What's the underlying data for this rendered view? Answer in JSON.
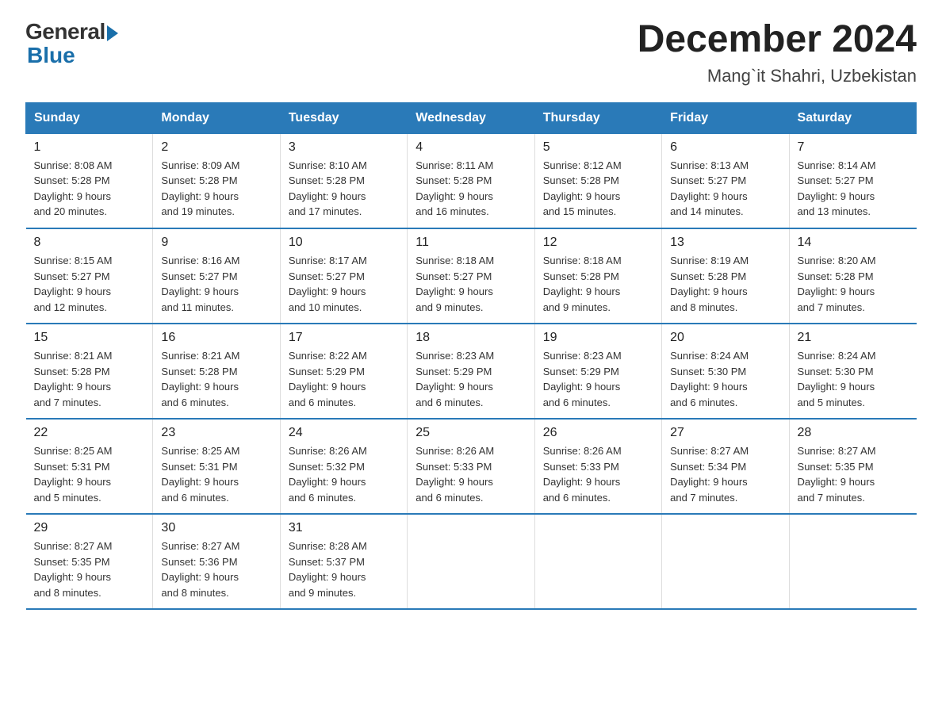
{
  "logo": {
    "general": "General",
    "blue": "Blue"
  },
  "title": "December 2024",
  "subtitle": "Mang`it Shahri, Uzbekistan",
  "headers": [
    "Sunday",
    "Monday",
    "Tuesday",
    "Wednesday",
    "Thursday",
    "Friday",
    "Saturday"
  ],
  "weeks": [
    [
      {
        "day": "1",
        "sunrise": "8:08 AM",
        "sunset": "5:28 PM",
        "daylight": "9 hours and 20 minutes."
      },
      {
        "day": "2",
        "sunrise": "8:09 AM",
        "sunset": "5:28 PM",
        "daylight": "9 hours and 19 minutes."
      },
      {
        "day": "3",
        "sunrise": "8:10 AM",
        "sunset": "5:28 PM",
        "daylight": "9 hours and 17 minutes."
      },
      {
        "day": "4",
        "sunrise": "8:11 AM",
        "sunset": "5:28 PM",
        "daylight": "9 hours and 16 minutes."
      },
      {
        "day": "5",
        "sunrise": "8:12 AM",
        "sunset": "5:28 PM",
        "daylight": "9 hours and 15 minutes."
      },
      {
        "day": "6",
        "sunrise": "8:13 AM",
        "sunset": "5:27 PM",
        "daylight": "9 hours and 14 minutes."
      },
      {
        "day": "7",
        "sunrise": "8:14 AM",
        "sunset": "5:27 PM",
        "daylight": "9 hours and 13 minutes."
      }
    ],
    [
      {
        "day": "8",
        "sunrise": "8:15 AM",
        "sunset": "5:27 PM",
        "daylight": "9 hours and 12 minutes."
      },
      {
        "day": "9",
        "sunrise": "8:16 AM",
        "sunset": "5:27 PM",
        "daylight": "9 hours and 11 minutes."
      },
      {
        "day": "10",
        "sunrise": "8:17 AM",
        "sunset": "5:27 PM",
        "daylight": "9 hours and 10 minutes."
      },
      {
        "day": "11",
        "sunrise": "8:18 AM",
        "sunset": "5:27 PM",
        "daylight": "9 hours and 9 minutes."
      },
      {
        "day": "12",
        "sunrise": "8:18 AM",
        "sunset": "5:28 PM",
        "daylight": "9 hours and 9 minutes."
      },
      {
        "day": "13",
        "sunrise": "8:19 AM",
        "sunset": "5:28 PM",
        "daylight": "9 hours and 8 minutes."
      },
      {
        "day": "14",
        "sunrise": "8:20 AM",
        "sunset": "5:28 PM",
        "daylight": "9 hours and 7 minutes."
      }
    ],
    [
      {
        "day": "15",
        "sunrise": "8:21 AM",
        "sunset": "5:28 PM",
        "daylight": "9 hours and 7 minutes."
      },
      {
        "day": "16",
        "sunrise": "8:21 AM",
        "sunset": "5:28 PM",
        "daylight": "9 hours and 6 minutes."
      },
      {
        "day": "17",
        "sunrise": "8:22 AM",
        "sunset": "5:29 PM",
        "daylight": "9 hours and 6 minutes."
      },
      {
        "day": "18",
        "sunrise": "8:23 AM",
        "sunset": "5:29 PM",
        "daylight": "9 hours and 6 minutes."
      },
      {
        "day": "19",
        "sunrise": "8:23 AM",
        "sunset": "5:29 PM",
        "daylight": "9 hours and 6 minutes."
      },
      {
        "day": "20",
        "sunrise": "8:24 AM",
        "sunset": "5:30 PM",
        "daylight": "9 hours and 6 minutes."
      },
      {
        "day": "21",
        "sunrise": "8:24 AM",
        "sunset": "5:30 PM",
        "daylight": "9 hours and 5 minutes."
      }
    ],
    [
      {
        "day": "22",
        "sunrise": "8:25 AM",
        "sunset": "5:31 PM",
        "daylight": "9 hours and 5 minutes."
      },
      {
        "day": "23",
        "sunrise": "8:25 AM",
        "sunset": "5:31 PM",
        "daylight": "9 hours and 6 minutes."
      },
      {
        "day": "24",
        "sunrise": "8:26 AM",
        "sunset": "5:32 PM",
        "daylight": "9 hours and 6 minutes."
      },
      {
        "day": "25",
        "sunrise": "8:26 AM",
        "sunset": "5:33 PM",
        "daylight": "9 hours and 6 minutes."
      },
      {
        "day": "26",
        "sunrise": "8:26 AM",
        "sunset": "5:33 PM",
        "daylight": "9 hours and 6 minutes."
      },
      {
        "day": "27",
        "sunrise": "8:27 AM",
        "sunset": "5:34 PM",
        "daylight": "9 hours and 7 minutes."
      },
      {
        "day": "28",
        "sunrise": "8:27 AM",
        "sunset": "5:35 PM",
        "daylight": "9 hours and 7 minutes."
      }
    ],
    [
      {
        "day": "29",
        "sunrise": "8:27 AM",
        "sunset": "5:35 PM",
        "daylight": "9 hours and 8 minutes."
      },
      {
        "day": "30",
        "sunrise": "8:27 AM",
        "sunset": "5:36 PM",
        "daylight": "9 hours and 8 minutes."
      },
      {
        "day": "31",
        "sunrise": "8:28 AM",
        "sunset": "5:37 PM",
        "daylight": "9 hours and 9 minutes."
      },
      null,
      null,
      null,
      null
    ]
  ]
}
